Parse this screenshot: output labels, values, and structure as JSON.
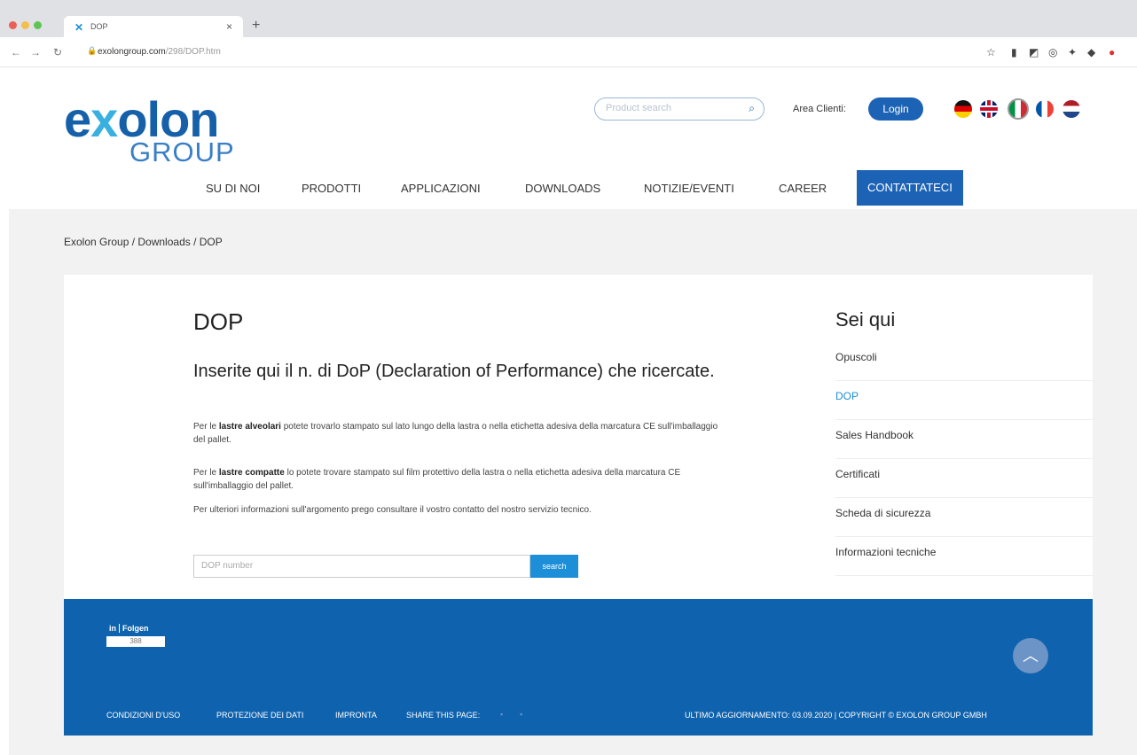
{
  "browser": {
    "tab_title": "DOP",
    "url_host": "exolongroup.com",
    "url_path": "/298/DOP.htm"
  },
  "header": {
    "logo_main_a": "e",
    "logo_main_x": "x",
    "logo_main_b": "olon",
    "logo_sub": "GROUP",
    "search_placeholder": "Product search",
    "area_label": "Area Clienti:",
    "login_label": "Login"
  },
  "nav": {
    "items": [
      "SU DI NOI",
      "PRODOTTI",
      "APPLICAZIONI",
      "DOWNLOADS",
      "NOTIZIE/EVENTI",
      "CAREER",
      "CONTATTATECI"
    ]
  },
  "breadcrumb": "Exolon Group / Downloads / DOP",
  "main": {
    "title": "DOP",
    "subheading": "Inserite qui il n. di DoP (Declaration of Performance) che ricercate.",
    "p1_pre": "Per le ",
    "p1_bold": "lastre alveolari",
    "p1_post": " potete trovarlo stampato sul lato lungo della lastra o nella etichetta adesiva della marcatura CE sull'imballaggio del pallet.",
    "p2_pre": "Per le ",
    "p2_bold": "lastre compatte",
    "p2_post": " lo potete trovare stampato sul film protettivo della lastra o nella etichetta adesiva della marcatura CE sull'imballaggio del pallet.",
    "p3": "Per ulteriori informazioni sull'argomento prego consultare il vostro contatto del nostro servizio tecnico.",
    "dop_placeholder": "DOP number",
    "search_button": "search"
  },
  "sidebar": {
    "title": "Sei qui",
    "items": [
      "Opuscoli",
      "DOP",
      "Sales Handbook",
      "Certificati",
      "Scheda di sicurezza",
      "Informazioni tecniche"
    ]
  },
  "footer": {
    "li_in": "in",
    "li_follow": "Folgen",
    "li_count": "388",
    "links": [
      "CONDIZIONI D'USO",
      "PROTEZIONE DEI DATI",
      "IMPRONTA",
      "SHARE THIS PAGE:"
    ],
    "right_text": "ULTIMO AGGIORNAMENTO: 03.09.2020 | COPYRIGHT © EXOLON GROUP GMBH"
  }
}
